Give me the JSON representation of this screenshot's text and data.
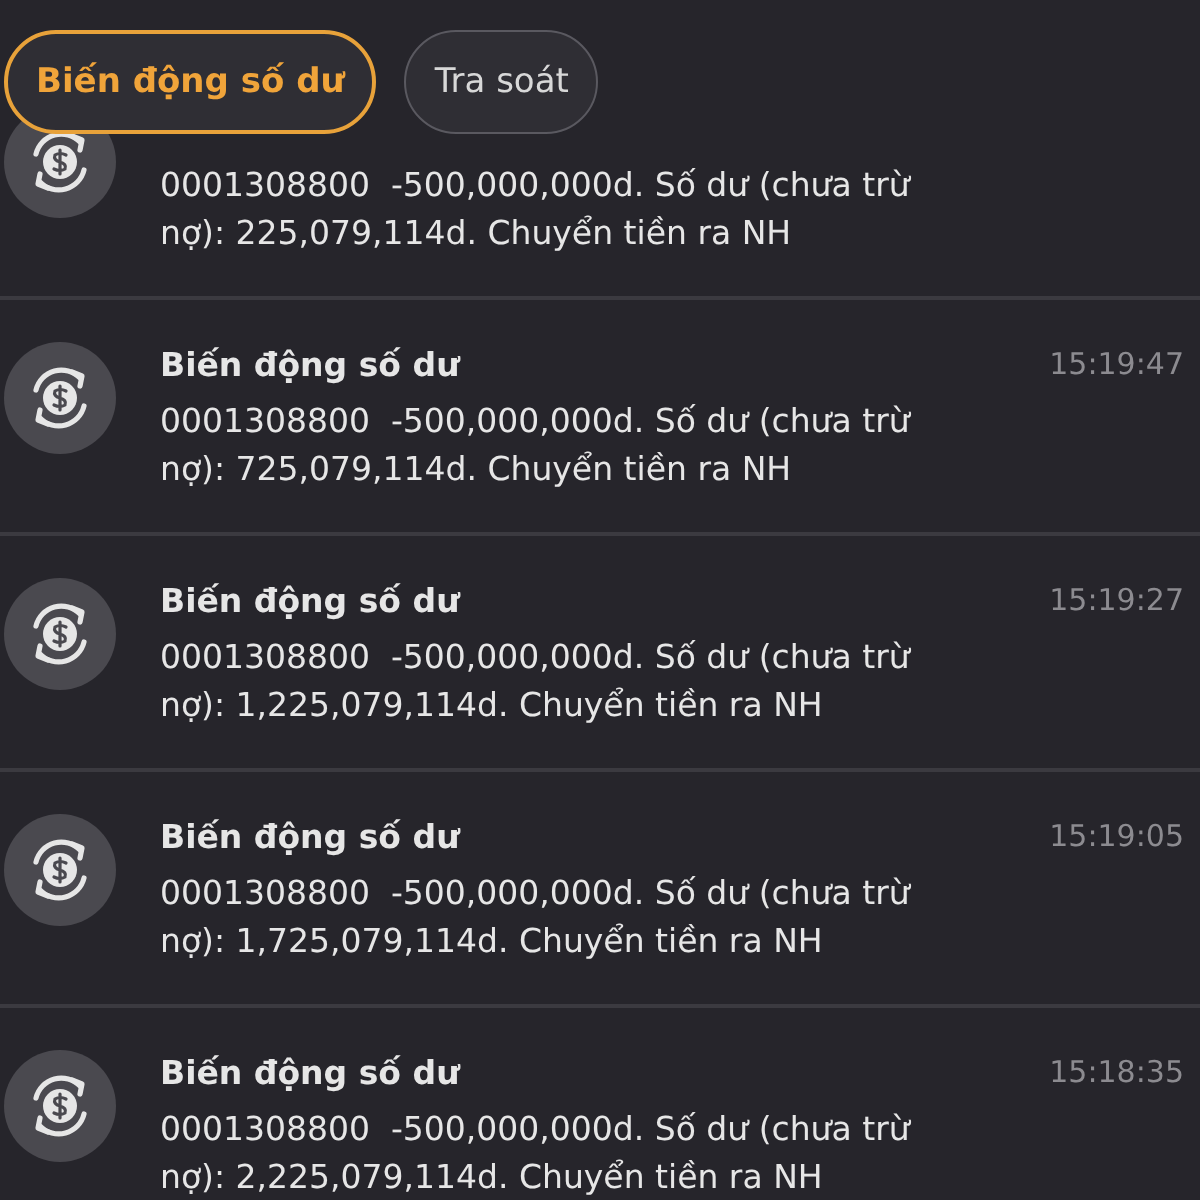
{
  "tabs": [
    {
      "label": "Biến động số dư",
      "selected": true
    },
    {
      "label": "Tra soát",
      "selected": false
    }
  ],
  "notifications": [
    {
      "body": "0001308800  -500,000,000d. Số dư (chưa trừ nợ): 225,079,114d. Chuyển tiền ra NH"
    },
    {
      "title": "Biến động số dư",
      "time": "15:19:47",
      "body": "0001308800  -500,000,000d. Số dư (chưa trừ nợ): 725,079,114d. Chuyển tiền ra NH"
    },
    {
      "title": "Biến động số dư",
      "time": "15:19:27",
      "body": "0001308800  -500,000,000d. Số dư (chưa trừ nợ): 1,225,079,114d. Chuyển tiền ra NH"
    },
    {
      "title": "Biến động số dư",
      "time": "15:19:05",
      "body": "0001308800  -500,000,000d. Số dư (chưa trừ nợ): 1,725,079,114d. Chuyển tiền ra NH"
    },
    {
      "title": "Biến động số dư",
      "time": "15:18:35",
      "body": "0001308800  -500,000,000d. Số dư (chưa trừ nợ): 2,225,079,114d. Chuyển tiền ra NH"
    }
  ]
}
